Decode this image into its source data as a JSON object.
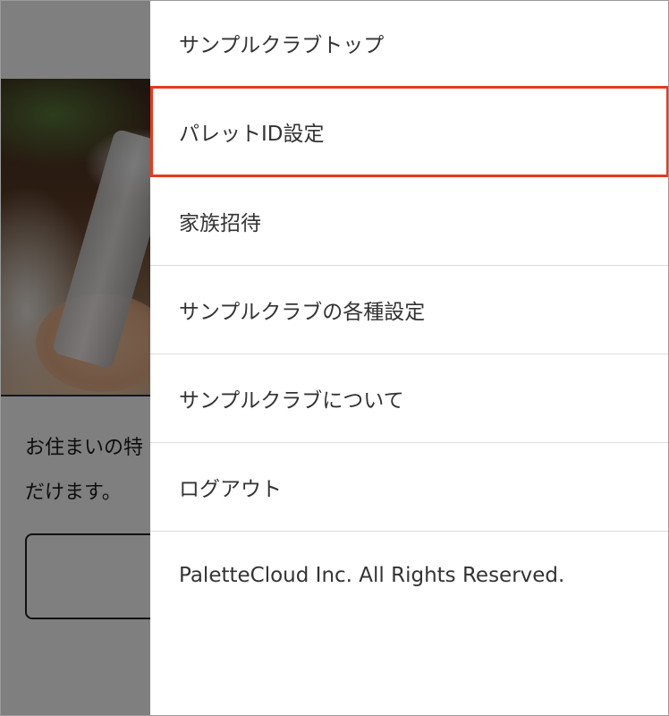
{
  "background_page": {
    "description_text_line1": "お住まいの特",
    "description_text_line2": "だけます。"
  },
  "drawer": {
    "menu_items": [
      {
        "label": "サンプルクラブトップ"
      },
      {
        "label": "パレットID設定",
        "highlighted": true
      },
      {
        "label": "家族招待"
      },
      {
        "label": "サンプルクラブの各種設定"
      },
      {
        "label": "サンプルクラブについて"
      },
      {
        "label": "ログアウト"
      }
    ],
    "copyright": "PaletteCloud Inc. All Rights Reserved."
  },
  "colors": {
    "highlight_border": "#e53b1e",
    "overlay": "rgba(0,0,0,0.5)",
    "menu_text": "#333333",
    "divider": "#dcdcdc"
  }
}
